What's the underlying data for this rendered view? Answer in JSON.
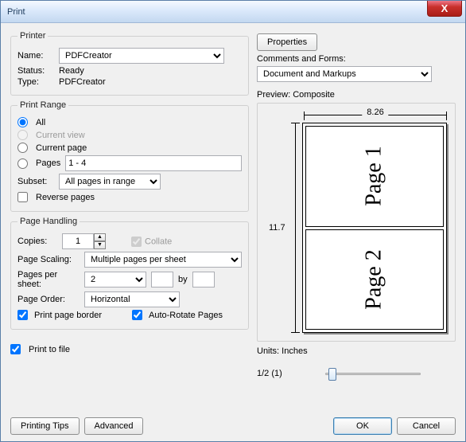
{
  "window": {
    "title": "Print",
    "close": "X"
  },
  "printer": {
    "legend": "Printer",
    "name_label": "Name:",
    "name_value": "PDFCreator",
    "status_label": "Status:",
    "status_value": "Ready",
    "type_label": "Type:",
    "type_value": "PDFCreator",
    "properties_btn": "Properties",
    "comments_label": "Comments and Forms:",
    "comments_value": "Document and Markups"
  },
  "range": {
    "legend": "Print Range",
    "all": "All",
    "current_view": "Current view",
    "current_page": "Current page",
    "pages": "Pages",
    "pages_value": "1 - 4",
    "subset_label": "Subset:",
    "subset_value": "All pages in range",
    "reverse": "Reverse pages"
  },
  "handling": {
    "legend": "Page Handling",
    "copies_label": "Copies:",
    "copies_value": "1",
    "collate": "Collate",
    "scaling_label": "Page Scaling:",
    "scaling_value": "Multiple pages per sheet",
    "pps_label": "Pages per sheet:",
    "pps_value": "2",
    "by": "by",
    "order_label": "Page Order:",
    "order_value": "Horizontal",
    "border": "Print page border",
    "auto_rotate": "Auto-Rotate Pages"
  },
  "print_to_file": "Print to file",
  "preview": {
    "label": "Preview: Composite",
    "width": "8.26",
    "height": "11.7",
    "page1": "Page 1",
    "page2": "Page 2",
    "units": "Units: Inches",
    "zoom": "1/2 (1)"
  },
  "buttons": {
    "tips": "Printing Tips",
    "advanced": "Advanced",
    "ok": "OK",
    "cancel": "Cancel"
  }
}
